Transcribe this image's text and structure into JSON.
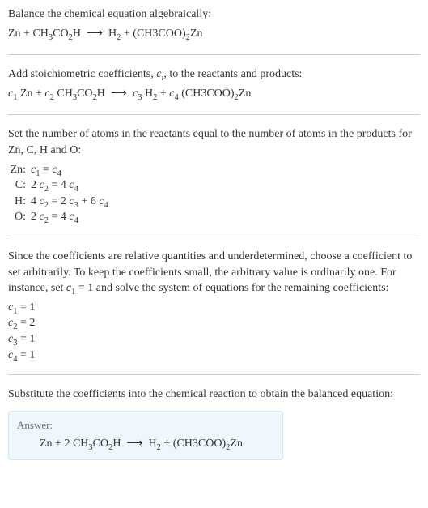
{
  "s1": {
    "intro": "Balance the chemical equation algebraically:",
    "eq": "Zn + CH<sub>3</sub>CO<sub>2</sub>H &nbsp;⟶&nbsp; H<sub>2</sub> + (CH3COO)<sub>2</sub>Zn"
  },
  "s2": {
    "intro": "Add stoichiometric coefficients, <span class='ital'>c<sub>i</sub></span>, to the reactants and products:",
    "eq": "<span class='ital'>c</span><sub>1</sub> Zn + <span class='ital'>c</span><sub>2</sub> CH<sub>3</sub>CO<sub>2</sub>H &nbsp;⟶&nbsp; <span class='ital'>c</span><sub>3</sub> H<sub>2</sub> + <span class='ital'>c</span><sub>4</sub> (CH3COO)<sub>2</sub>Zn"
  },
  "s3": {
    "intro": "Set the number of atoms in the reactants equal to the number of atoms in the products for Zn, C, H and O:",
    "rows": [
      {
        "el": "Zn:",
        "eq": "<span class='ital'>c</span><sub>1</sub> = <span class='ital'>c</span><sub>4</sub>"
      },
      {
        "el": "C:",
        "eq": "2 <span class='ital'>c</span><sub>2</sub> = 4 <span class='ital'>c</span><sub>4</sub>"
      },
      {
        "el": "H:",
        "eq": "4 <span class='ital'>c</span><sub>2</sub> = 2 <span class='ital'>c</span><sub>3</sub> + 6 <span class='ital'>c</span><sub>4</sub>"
      },
      {
        "el": "O:",
        "eq": "2 <span class='ital'>c</span><sub>2</sub> = 4 <span class='ital'>c</span><sub>4</sub>"
      }
    ]
  },
  "s4": {
    "intro": "Since the coefficients are relative quantities and underdetermined, choose a coefficient to set arbitrarily. To keep the coefficients small, the arbitrary value is ordinarily one. For instance, set <span class='ital'>c</span><sub>1</sub> = 1 and solve the system of equations for the remaining coefficients:",
    "coeffs": [
      "<span class='ital'>c</span><sub>1</sub> = 1",
      "<span class='ital'>c</span><sub>2</sub> = 2",
      "<span class='ital'>c</span><sub>3</sub> = 1",
      "<span class='ital'>c</span><sub>4</sub> = 1"
    ]
  },
  "s5": {
    "intro": "Substitute the coefficients into the chemical reaction to obtain the balanced equation:",
    "answer_label": "Answer:",
    "answer_eq": "Zn + 2 CH<sub>3</sub>CO<sub>2</sub>H &nbsp;⟶&nbsp; H<sub>2</sub> + (CH3COO)<sub>2</sub>Zn"
  }
}
